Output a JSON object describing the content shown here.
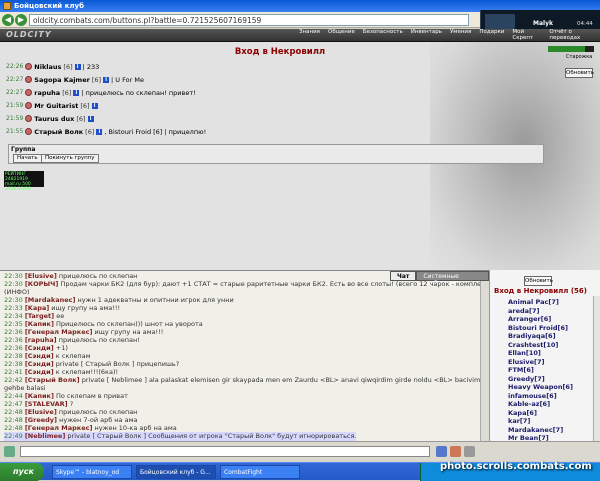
{
  "window": {
    "title": "Бойцовский клуб"
  },
  "browser": {
    "url": "oldcity.combats.com/buttons.pl?battle=0.721525607169159"
  },
  "player": {
    "name": "Malyk",
    "time": "04:44"
  },
  "game": {
    "logo": "OLDCITY",
    "nav": [
      "Знания",
      "Общение",
      "Безопасность",
      "Инвентарь",
      "Умения",
      "Подарки",
      "Мой Скрепт",
      "Отчёт о переводах"
    ]
  },
  "main": {
    "heading": "Вход в Некровилл",
    "hp": "Старожка",
    "refresh_label": "Обновить",
    "rows": [
      {
        "time": "22:26",
        "name": "Niklaus",
        "level": "[6]",
        "msg": "| 233"
      },
      {
        "time": "22:27",
        "name": "Sagopa Kajmer",
        "level": "[6]",
        "msg": "| U For Me"
      },
      {
        "time": "22:27",
        "name": "rapuha",
        "level": "[6]",
        "msg": "| прицелюсь по склепан! привет!"
      },
      {
        "time": "21:59",
        "name": "Mr Guitarist",
        "level": "[6]",
        "msg": ""
      },
      {
        "time": "21:59",
        "name": "Taurus dux",
        "level": "[6]",
        "msg": ""
      },
      {
        "time": "21:55",
        "name": "Старый Волк",
        "level": "[6]",
        "msg": ", Bistouri Froid [6] | прицелпю!"
      }
    ],
    "group": {
      "title": "Группа",
      "start_label": "Начать",
      "leave_label": "Покинуть группу"
    },
    "counter": "РЕЙТИНГ 24821919 mail.ru 500 2510 25/19"
  },
  "chat": {
    "tabs": [
      "Чат",
      "Системные сообщения"
    ],
    "lines": [
      {
        "time": "22:30",
        "nick": "[Elusive]",
        "text": "прицелюсь по склепан"
      },
      {
        "time": "22:30",
        "nick": "[КОРЫЧ]",
        "text": "Продам чарки БК2 (для бур): дают +1 СТАТ = старые раритетные чарки БК2. Есть во все слоты! (всего 12 чарок - комплект)"
      },
      {
        "time": "",
        "nick": "",
        "text": "(ИНФО)"
      },
      {
        "time": "22:30",
        "nick": "[Mardakanec]",
        "text": "нужн 1 адекватны и опитнни игрок для унни"
      },
      {
        "time": "22:33",
        "nick": "[Kapa]",
        "text": "ищу групу на ама!!!"
      },
      {
        "time": "22:34",
        "nick": "[Target]",
        "text": "ее"
      },
      {
        "time": "22:35",
        "nick": "[Капик]",
        "text": "Прицелюсь по склепан))) шнот на уворота"
      },
      {
        "time": "22:36",
        "nick": "[Генерал Маркес]",
        "text": "ищу групу на ама!!!"
      },
      {
        "time": "22:36",
        "nick": "[rapuha]",
        "text": "прицелюсь по склепан!"
      },
      {
        "time": "22:36",
        "nick": "[Сэнди]",
        "text": "+1)"
      },
      {
        "time": "22:38",
        "nick": "[Сэнди]",
        "text": "к склепам"
      },
      {
        "time": "22:38",
        "nick": "[Сэнди]",
        "text": "private [ Старый Волк ] прицепишь?"
      },
      {
        "time": "22:41",
        "nick": "[Сэнди]",
        "text": "к склепам!!!(6ка)!"
      },
      {
        "time": "22:42",
        "nick": "[Старый Волк]",
        "text": "private [ Neblimee ] ala palaskat elemisen gir skaypada men em Zaurdu <ВL> anavi qiwqirdim girde noldu <ВL> bacivim girde ay"
      },
      {
        "time": "",
        "nick": "",
        "text": "gehbe balasi"
      },
      {
        "time": "22:44",
        "nick": "[Капик]",
        "text": "По склепам в приват"
      },
      {
        "time": "22:47",
        "nick": "[STALEVAR]",
        "text": "?"
      },
      {
        "time": "22:48",
        "nick": "[Elusive]",
        "text": "прицелюсь по склепан"
      },
      {
        "time": "22:48",
        "nick": "[Greedy]",
        "text": "нужен 7-ой арб на ама"
      },
      {
        "time": "22:48",
        "nick": "[Генерал Маркес]",
        "text": "нужен 10-ка арб на ама"
      },
      {
        "time": "22:49",
        "nick": "[Neblimee]",
        "text": "private [ Старый Волк ] Сообщения от игрока \"Старый Волк\" будут игнорироваться."
      }
    ]
  },
  "online": {
    "refresh_label": "Обновить",
    "title": "Вход в Некровилл (56)",
    "users": [
      "Animal Pac[7]",
      "areda[7]",
      "Arranger[6]",
      "Bistouri Froid[6]",
      "Bradiyaqa[6]",
      "Crashtest[10]",
      "Ellan[10]",
      "Elusive[7]",
      "FTM[6]",
      "Greedy[7]",
      "Heavy Weapon[6]",
      "infamouse[6]",
      "Kable-az[6]",
      "Kapa[6]",
      "kar[7]",
      "Mardakanec[7]",
      "Mr Bean[7]"
    ]
  },
  "taskbar": {
    "start": "пуск",
    "tasks": [
      "Skype™ - blatnoy_od",
      "Бойцовский клуб - G...",
      "CombatFight"
    ]
  },
  "watermark": "photo.scrolls.combats.com"
}
